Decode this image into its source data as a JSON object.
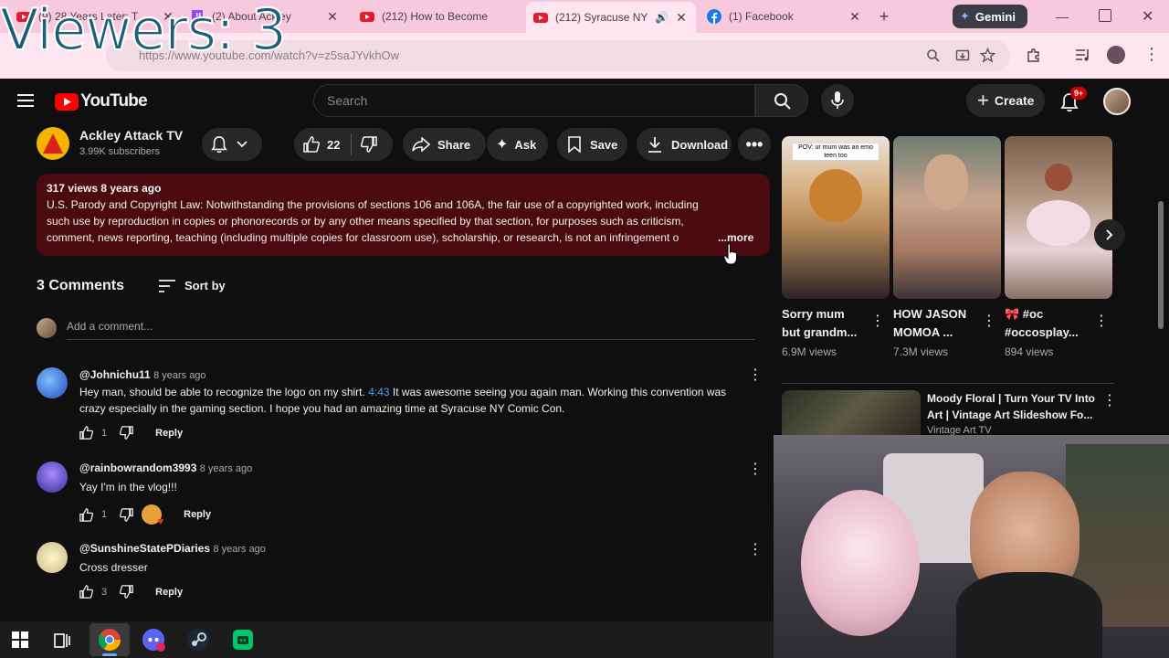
{
  "overlay": {
    "viewers": "Viewers: 3"
  },
  "browser": {
    "tabs": [
      {
        "title": "(9) 28 Years Later: T",
        "favicon": "youtube-icon"
      },
      {
        "title": "(2) About Ackley",
        "favicon": "twitch-icon"
      },
      {
        "title": "(212) How to Become",
        "favicon": "youtube-icon"
      },
      {
        "title": "(212) Syracuse NY",
        "favicon": "youtube-icon",
        "active": true
      },
      {
        "title": "(1) Facebook",
        "favicon": "facebook-icon"
      }
    ],
    "gemini_label": "Gemini",
    "url": "https://www.youtube.com/watch?v=z5saJYvkhOw"
  },
  "youtube": {
    "logo_text": "YouTube",
    "search_placeholder": "Search",
    "create_label": "Create",
    "notification_count": "9+"
  },
  "channel": {
    "name": "Ackley Attack TV",
    "subscribers": "3.99K subscribers",
    "likes": "22",
    "actions": {
      "share": "Share",
      "ask": "Ask",
      "save": "Save",
      "download": "Download"
    }
  },
  "description": {
    "stats": "317 views  8 years ago",
    "lines": [
      "U.S. Parody and Copyright Law: Notwithstanding the provisions of sections 106 and 106A, the fair use of a copyrighted work, including",
      "such use by reproduction in copies or phonorecords or by any other means specified by that section, for purposes such as criticism,",
      "comment, news reporting, teaching (including multiple copies for classroom use), scholarship, or research, is not an infringement o"
    ],
    "more_label": "...more"
  },
  "comments": {
    "count_label": "3 Comments",
    "sort_label": "Sort by",
    "add_placeholder": "Add a comment...",
    "items": [
      {
        "user": "@Johnichu11",
        "time": "8 years ago",
        "text_before": "Hey man, should be able to recognize the logo on my shirt. ",
        "timestamp": "4:43",
        "text_after": " It was awesome seeing you again man. Working this convention was",
        "text_line2": "crazy especially in the gaming section. I hope you had an amazing time at Syracuse NY Comic Con.",
        "likes": "1",
        "reply": "Reply"
      },
      {
        "user": "@rainbowrandom3993",
        "time": "8 years ago",
        "text": "Yay I'm in the vlog!!!",
        "likes": "1",
        "reply": "Reply"
      },
      {
        "user": "@SunshineStatePDiaries",
        "time": "8 years ago",
        "text": "Cross dresser",
        "likes": "3",
        "reply": "Reply"
      }
    ]
  },
  "shorts": [
    {
      "title1": "Sorry mum",
      "title2": "but grandm...",
      "views": "6.9M views",
      "caption": "POV: ur mum was an emo teen too"
    },
    {
      "title1": "HOW JASON",
      "title2": "MOMOA ...",
      "views": "7.3M views"
    },
    {
      "title1": "🎀 #oc",
      "title2": "#occosplay...",
      "views": "894 views"
    }
  ],
  "recommended": {
    "title1": "Moody Floral | Turn Your TV Into",
    "title2": "Art | Vintage Art Slideshow Fo...",
    "channel": "Vintage Art TV"
  }
}
